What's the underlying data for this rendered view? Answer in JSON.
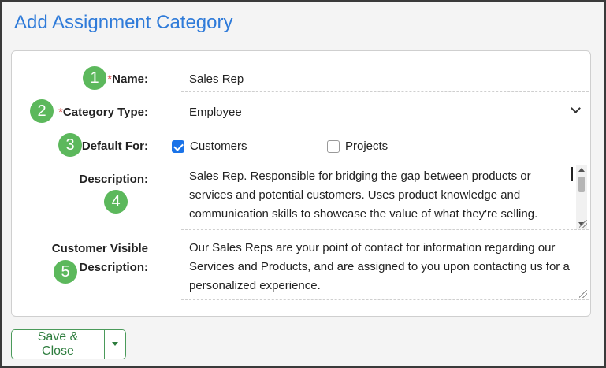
{
  "title": "Add Assignment Category",
  "form": {
    "name": {
      "badge": "1",
      "required_mark": "*",
      "label": "Name:",
      "value": "Sales Rep"
    },
    "category_type": {
      "badge": "2",
      "required_mark": "*",
      "label": "Category Type:",
      "value": "Employee"
    },
    "default_for": {
      "badge": "3",
      "label": "Default For:",
      "options": [
        {
          "label": "Customers",
          "checked": true
        },
        {
          "label": "Projects",
          "checked": false
        }
      ]
    },
    "description": {
      "badge": "4",
      "label": "Description:",
      "value": "Sales Rep. Responsible for bridging the gap between products or services and potential customers. Uses product knowledge and communication skills to showcase the value of what they're selling."
    },
    "customer_visible_description": {
      "badge": "5",
      "label_line1": "Customer Visible",
      "label_line2": "Description:",
      "value": "Our Sales Reps are your point of contact for information regarding our Services and Products, and are assigned to you upon contacting us for a personalized experience."
    }
  },
  "actions": {
    "save_close_label": "Save & Close",
    "dropdown_icon": "caret-down-icon"
  },
  "colors": {
    "title": "#2f7bd9",
    "badge": "#5cb85c",
    "required": "#d9534f",
    "checkbox": "#1a73e8",
    "button": "#2e7d3e"
  }
}
